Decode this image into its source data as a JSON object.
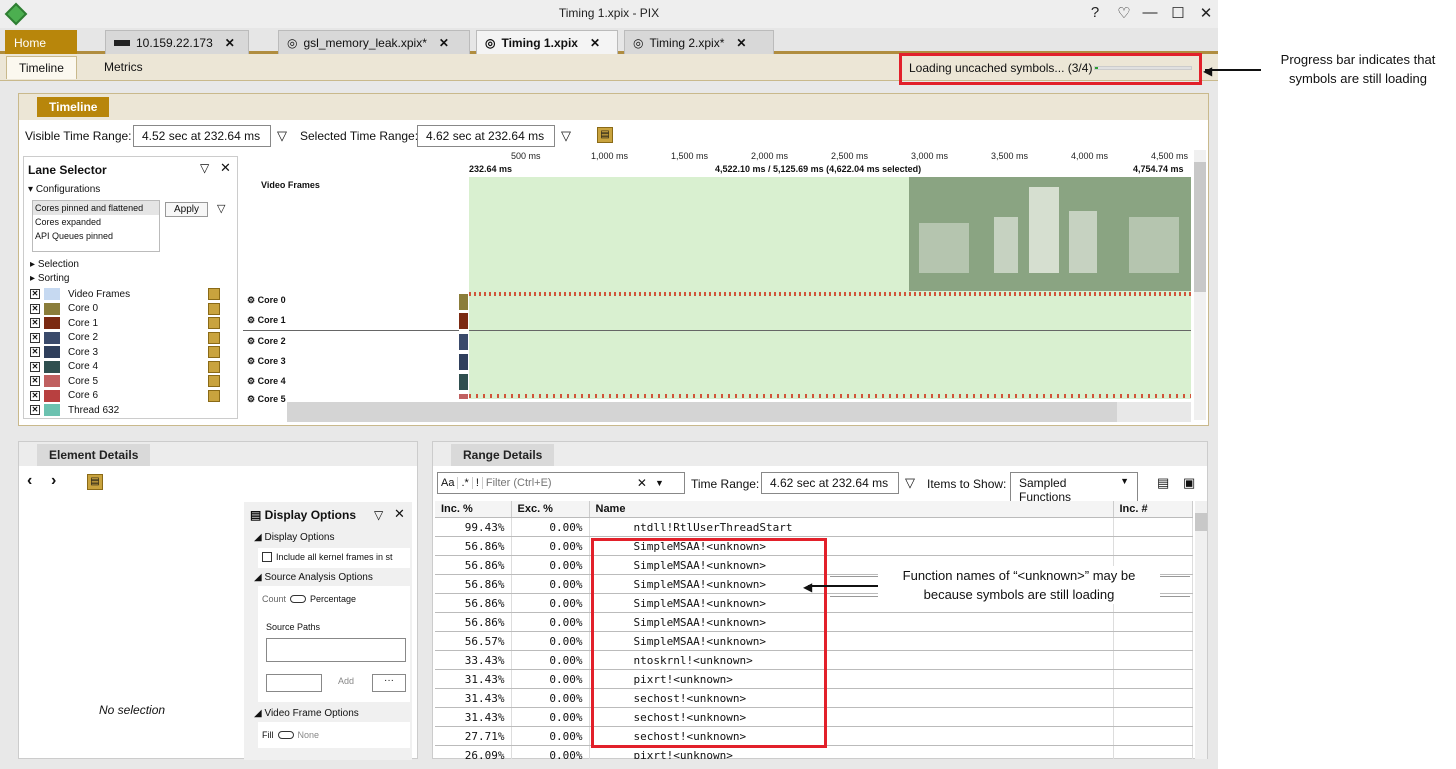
{
  "window": {
    "title": "Timing 1.xpix - PIX",
    "buttons": [
      "?",
      "♡",
      "—",
      "☐",
      "✕"
    ]
  },
  "tabs": [
    {
      "label": "Home"
    },
    {
      "label": "10.159.22.173"
    },
    {
      "label": "gsl_memory_leak.xpix*"
    },
    {
      "label": "Timing 1.xpix"
    },
    {
      "label": "Timing 2.xpix*"
    }
  ],
  "subtabs": [
    "Timeline",
    "Metrics"
  ],
  "loading": {
    "text": "Loading uncached symbols... (3/4)",
    "progress_fraction": 0.03
  },
  "annotations": {
    "progress": "Progress bar indicates that symbols are still loading",
    "unknown": "Function names of “<unknown>” may be because symbols are still loading"
  },
  "timeline": {
    "tab": "Timeline",
    "visible_label": "Visible Time Range:",
    "visible_value": "4.52 sec at 232.64 ms",
    "selected_label": "Selected Time Range:",
    "selected_value": "4.62 sec at 232.64 ms",
    "ruler_ticks": [
      "500 ms",
      "1,000 ms",
      "1,500 ms",
      "2,000 ms",
      "2,500 ms",
      "3,000 ms",
      "3,500 ms",
      "4,000 ms",
      "4,500 ms"
    ],
    "ruler_start": "232.64 ms",
    "ruler_selection": "4,522.10 ms / 5,125.69 ms (4,622.04 ms selected)",
    "ruler_end": "4,754.74 ms",
    "lanes": [
      "Video Frames",
      "Core 0",
      "Core 1",
      "Core 2",
      "Core 3",
      "Core 4",
      "Core 5"
    ]
  },
  "lane_selector": {
    "title": "Lane Selector",
    "configurations_label": "Configurations",
    "configurations": [
      "Cores pinned and flattened",
      "Cores expanded",
      "API Queues pinned"
    ],
    "apply": "Apply",
    "selection": "Selection",
    "sorting": "Sorting",
    "items": [
      {
        "label": "Video Frames",
        "color": "#c6d9f1"
      },
      {
        "label": "Core 0",
        "color": "#8b7d3a"
      },
      {
        "label": "Core 1",
        "color": "#7b2a12"
      },
      {
        "label": "Core 2",
        "color": "#3a4a6b"
      },
      {
        "label": "Core 3",
        "color": "#2f3f5c"
      },
      {
        "label": "Core 4",
        "color": "#2f4f4f"
      },
      {
        "label": "Core 5",
        "color": "#c06060"
      },
      {
        "label": "Core 6",
        "color": "#b84040"
      },
      {
        "label": "Thread 632",
        "color": "#6cc2b0"
      }
    ]
  },
  "element_details": {
    "tab": "Element Details",
    "empty": "No selection",
    "display_options": {
      "title": "Display Options",
      "section1": "Display Options",
      "kernel": "Include all kernel frames in st",
      "section2": "Source Analysis Options",
      "count": "Count",
      "percentage": "Percentage",
      "source_paths": "Source Paths",
      "add": "Add",
      "more": "···",
      "section3": "Video Frame Options",
      "fill": "Fill",
      "none": "None"
    }
  },
  "range_details": {
    "tab": "Range Details",
    "aa": "Aa",
    "regex": ".*",
    "bang": "!",
    "filter_placeholder": "Filter (Ctrl+E)",
    "time_range_label": "Time Range:",
    "time_range_value": "4.62 sec at 232.64 ms",
    "items_label": "Items to Show:",
    "items_value": "Sampled Functions",
    "columns": [
      "Inc. %",
      "Exc. %",
      "Name",
      "Inc. #"
    ],
    "rows": [
      {
        "inc": "99.43%",
        "exc": "0.00%",
        "name": "ntdll!RtlUserThreadStart"
      },
      {
        "inc": "56.86%",
        "exc": "0.00%",
        "name": "SimpleMSAA!<unknown>"
      },
      {
        "inc": "56.86%",
        "exc": "0.00%",
        "name": "SimpleMSAA!<unknown>"
      },
      {
        "inc": "56.86%",
        "exc": "0.00%",
        "name": "SimpleMSAA!<unknown>"
      },
      {
        "inc": "56.86%",
        "exc": "0.00%",
        "name": "SimpleMSAA!<unknown>"
      },
      {
        "inc": "56.86%",
        "exc": "0.00%",
        "name": "SimpleMSAA!<unknown>"
      },
      {
        "inc": "56.57%",
        "exc": "0.00%",
        "name": "SimpleMSAA!<unknown>"
      },
      {
        "inc": "33.43%",
        "exc": "0.00%",
        "name": "ntoskrnl!<unknown>"
      },
      {
        "inc": "31.43%",
        "exc": "0.00%",
        "name": "pixrt!<unknown>"
      },
      {
        "inc": "31.43%",
        "exc": "0.00%",
        "name": "sechost!<unknown>"
      },
      {
        "inc": "31.43%",
        "exc": "0.00%",
        "name": "sechost!<unknown>"
      },
      {
        "inc": "27.71%",
        "exc": "0.00%",
        "name": "sechost!<unknown>"
      },
      {
        "inc": "26.09%",
        "exc": "0.00%",
        "name": "pixrt!<unknown>"
      }
    ]
  }
}
